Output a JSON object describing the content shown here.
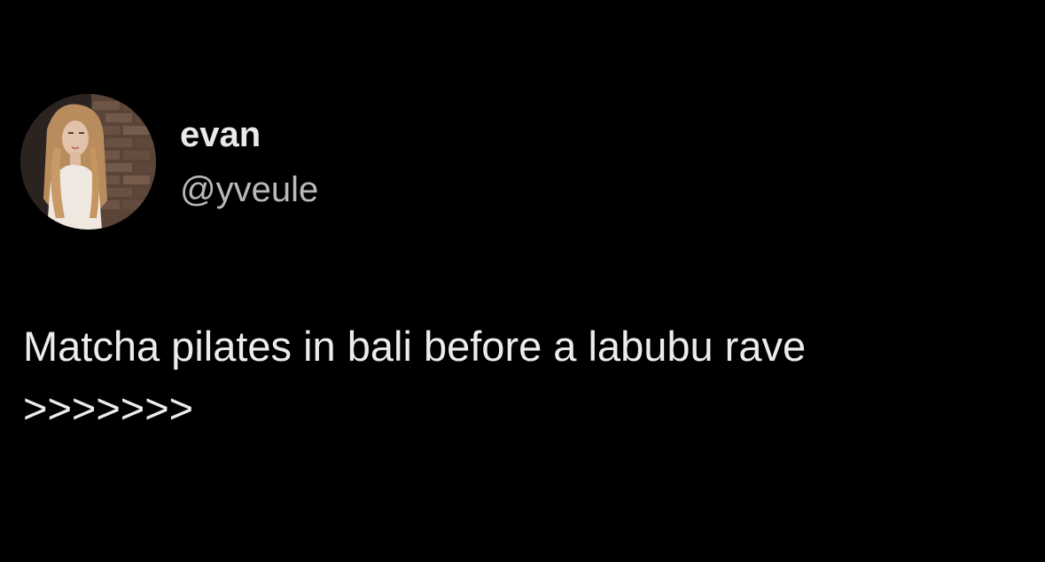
{
  "tweet": {
    "author": {
      "display_name": "evan",
      "handle": "@yveule",
      "avatar_icon": "profile-photo"
    },
    "text_lines": [
      "Matcha pilates in bali before a labubu rave",
      ">>>>>>>"
    ]
  },
  "colors": {
    "background": "#000000",
    "primary_text": "#e7e9ea",
    "secondary_text": "#b7b9bd"
  }
}
